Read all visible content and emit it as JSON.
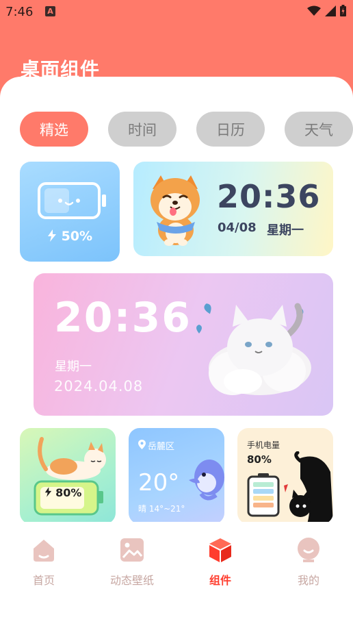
{
  "status_bar": {
    "time": "7:46",
    "notification_icon": "A"
  },
  "header": {
    "title": "桌面组件"
  },
  "tabs": [
    {
      "label": "精选",
      "active": true
    },
    {
      "label": "时间",
      "active": false
    },
    {
      "label": "日历",
      "active": false
    },
    {
      "label": "天气",
      "active": false
    }
  ],
  "widgets": {
    "battery": {
      "percent": "50%"
    },
    "shiba_clock": {
      "time": "20:36",
      "date": "04/08",
      "weekday": "星期一"
    },
    "cat_clock": {
      "time": "20:36",
      "weekday": "星期一",
      "date": "2024.04.08"
    },
    "cat_battery": {
      "percent": "80%"
    },
    "weather": {
      "location": "岳麓区",
      "temperature": "20°",
      "condition_range": "晴 14°~21°"
    },
    "phone_battery": {
      "label": "手机电量",
      "percent": "80%"
    }
  },
  "bottom_nav": [
    {
      "label": "首页",
      "icon": "home-icon",
      "active": false
    },
    {
      "label": "动态壁纸",
      "icon": "image-icon",
      "active": false
    },
    {
      "label": "组件",
      "icon": "cube-icon",
      "active": true
    },
    {
      "label": "我的",
      "icon": "profile-icon",
      "active": false
    }
  ],
  "colors": {
    "accent": "#ff7a6a",
    "nav_active": "#ff3d2e",
    "nav_inactive": "#c7a7a2"
  }
}
